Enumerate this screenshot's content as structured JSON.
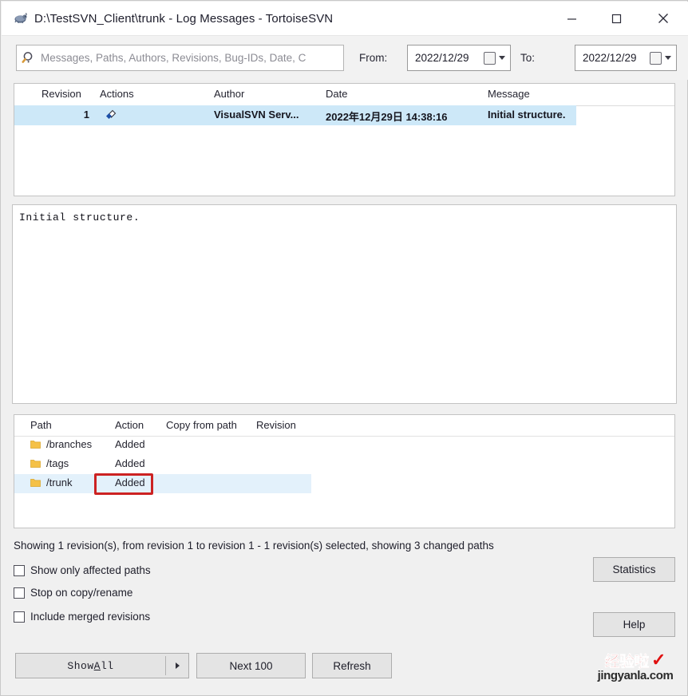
{
  "window": {
    "title": "D:\\TestSVN_Client\\trunk - Log Messages - TortoiseSVN",
    "icon": "tortoisesvn-icon",
    "controls": {
      "minimize": "–",
      "maximize": "❐",
      "close": "✕"
    }
  },
  "filter": {
    "search_placeholder": "Messages, Paths, Authors, Revisions, Bug-IDs, Date, C",
    "search_value": "",
    "from_label": "From:",
    "from_value": "2022/12/29",
    "to_label": "To:",
    "to_value": "2022/12/29"
  },
  "log_list": {
    "columns": [
      "Revision",
      "Actions",
      "Author",
      "Date",
      "Message"
    ],
    "rows": [
      {
        "revision": "1",
        "action_icon": "add-diamond-icon",
        "author": "VisualSVN Serv...",
        "date": "2022年12月29日 14:38:16",
        "message": "Initial structure.",
        "selected": true
      }
    ]
  },
  "commit_message": {
    "text": "Initial structure."
  },
  "paths_list": {
    "columns": [
      "Path",
      "Action",
      "Copy from path",
      "Revision"
    ],
    "rows": [
      {
        "path": "/branches",
        "action": "Added",
        "copy_from_path": "",
        "revision": "",
        "selected": false
      },
      {
        "path": "/tags",
        "action": "Added",
        "copy_from_path": "",
        "revision": "",
        "selected": false
      },
      {
        "path": "/trunk",
        "action": "Added",
        "copy_from_path": "",
        "revision": "",
        "selected": true
      }
    ],
    "annotation": {
      "target": "/trunk Added",
      "color": "#cc2222"
    }
  },
  "status": {
    "text": "Showing 1 revision(s), from revision 1 to revision 1 - 1 revision(s) selected, showing 3 changed paths"
  },
  "options": [
    {
      "label": "Show only affected paths",
      "checked": false
    },
    {
      "label": "Stop on copy/rename",
      "checked": false
    },
    {
      "label": "Include merged revisions",
      "checked": false
    }
  ],
  "buttons": {
    "statistics": "Statistics",
    "help": "Help",
    "show_all": "Show All",
    "show_all_prefix": "Show ",
    "show_all_accel": "A",
    "show_all_suffix": "ll",
    "next_100": "Next 100",
    "refresh": "Refresh"
  },
  "watermark": {
    "cn_text": "经验啦",
    "check": "✓",
    "url": "jingyanla.com"
  },
  "colors": {
    "selection": "#cde8f8",
    "row_highlight": "#e3f1fb",
    "annotation": "#cc2222",
    "window_bg": "#f0f0f0"
  }
}
